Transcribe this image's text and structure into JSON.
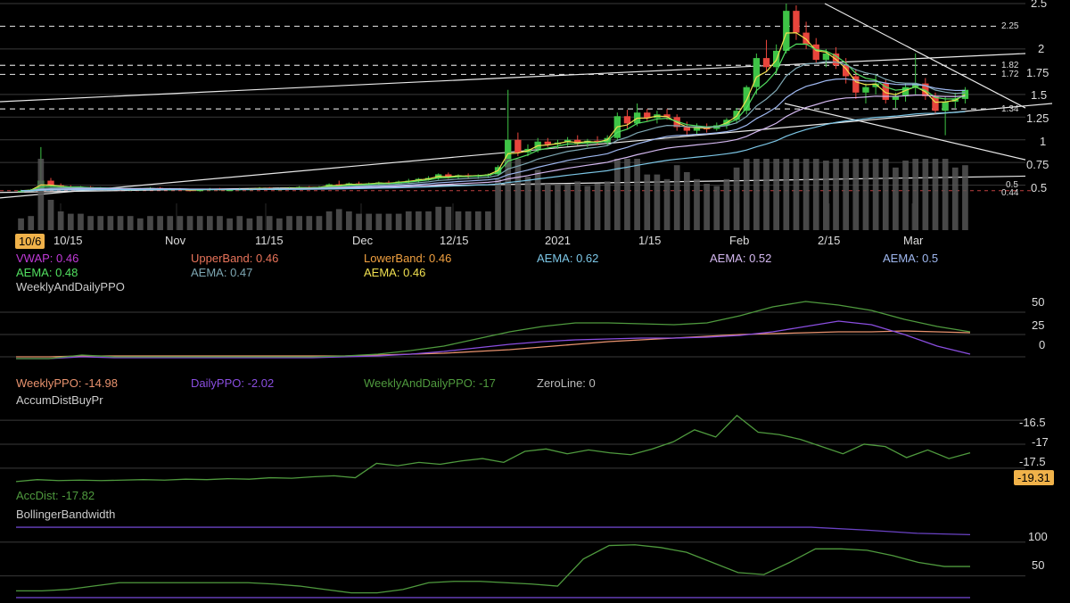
{
  "colors": {
    "up": "#3ec446",
    "down": "#e8453c",
    "volume": "#555555",
    "grid": "#3a3a3a",
    "ppo_weekly": "#e8926e",
    "ppo_daily": "#8a4ee0",
    "ppo_combined": "#4f9a3e",
    "accdist": "#4f9a3e",
    "bbw": "#4f9a3e",
    "bbw_upper": "#6a42c4",
    "badge": "#f0b24a"
  },
  "price_panel": {
    "y_ticks": [
      "2.5",
      "2.25",
      "2",
      "1.82",
      "1.72",
      "1.75",
      "1.5",
      "1.34",
      "1.25",
      "1",
      "0.75",
      "0.5",
      "0.5",
      "0.44"
    ],
    "x_ticks": [
      "10/6",
      "10/15",
      "Nov",
      "11/15",
      "Dec",
      "12/15",
      "2021",
      "1/15",
      "Feb",
      "2/15",
      "Mar"
    ],
    "legend": [
      {
        "text": "VWAP: 0.46",
        "color": "#c03ad8"
      },
      {
        "text": "UpperBand: 0.46",
        "color": "#e8735a"
      },
      {
        "text": "LowerBand: 0.46",
        "color": "#f0a040"
      },
      {
        "text": "AEMA: 0.62",
        "color": "#7cc6e6"
      },
      {
        "text": "AEMA: 0.52",
        "color": "#d4b8f0"
      },
      {
        "text": "AEMA: 0.5",
        "color": "#9fb8f0"
      },
      {
        "text": "AEMA: 0.48",
        "color": "#52e060"
      },
      {
        "text": "AEMA: 0.47",
        "color": "#7ea7b3"
      },
      {
        "text": "AEMA: 0.46",
        "color": "#f0e050"
      }
    ]
  },
  "ppo_panel": {
    "title": "WeeklyAndDailyPPO",
    "y_ticks": [
      "50",
      "25",
      "0"
    ],
    "legend": [
      {
        "text": "WeeklyPPO: -14.98",
        "color": "#e8926e"
      },
      {
        "text": "DailyPPO: -2.02",
        "color": "#8a4ee0"
      },
      {
        "text": "WeeklyAndDailyPPO: -17",
        "color": "#4f9a3e"
      },
      {
        "text": "ZeroLine: 0",
        "color": "#bbbbbb"
      }
    ]
  },
  "accdist_panel": {
    "title": "AccumDistBuyPr",
    "y_ticks": [
      "-16.5",
      "-17",
      "-17.5"
    ],
    "legend": {
      "text": "AccDist: -17.82",
      "color": "#4f9a3e"
    },
    "badge": "-19.31"
  },
  "bbw_panel": {
    "title": "BollingerBandwidth",
    "y_ticks": [
      "100",
      "50"
    ]
  },
  "chart_data": [
    {
      "type": "candlestick",
      "ylim": [
        0.3,
        2.5
      ],
      "x": [
        "10/6",
        "10/15",
        "Nov",
        "11/15",
        "Dec",
        "12/15",
        "2021",
        "1/15",
        "Feb",
        "2/15",
        "Mar"
      ],
      "series": [
        {
          "values": [
            [
              0.44,
              0.45,
              0.43,
              0.44
            ],
            [
              0.44,
              0.46,
              0.43,
              0.45
            ],
            [
              0.45,
              0.92,
              0.44,
              0.55
            ],
            [
              0.55,
              0.58,
              0.48,
              0.5
            ],
            [
              0.5,
              0.52,
              0.47,
              0.48
            ],
            [
              0.48,
              0.5,
              0.46,
              0.47
            ],
            [
              0.47,
              0.49,
              0.45,
              0.48
            ],
            [
              0.48,
              0.49,
              0.46,
              0.46
            ],
            [
              0.46,
              0.48,
              0.45,
              0.47
            ],
            [
              0.47,
              0.48,
              0.45,
              0.46
            ],
            [
              0.46,
              0.47,
              0.44,
              0.45
            ],
            [
              0.45,
              0.47,
              0.44,
              0.46
            ],
            [
              0.46,
              0.47,
              0.45,
              0.46
            ],
            [
              0.46,
              0.48,
              0.45,
              0.47
            ],
            [
              0.47,
              0.48,
              0.45,
              0.45
            ],
            [
              0.45,
              0.47,
              0.44,
              0.46
            ],
            [
              0.46,
              0.47,
              0.44,
              0.45
            ],
            [
              0.45,
              0.46,
              0.43,
              0.44
            ],
            [
              0.44,
              0.46,
              0.43,
              0.45
            ],
            [
              0.45,
              0.47,
              0.44,
              0.46
            ],
            [
              0.46,
              0.47,
              0.44,
              0.45
            ],
            [
              0.45,
              0.46,
              0.44,
              0.45
            ],
            [
              0.45,
              0.47,
              0.44,
              0.46
            ],
            [
              0.46,
              0.47,
              0.45,
              0.46
            ],
            [
              0.46,
              0.48,
              0.45,
              0.47
            ],
            [
              0.47,
              0.48,
              0.45,
              0.46
            ],
            [
              0.46,
              0.47,
              0.45,
              0.46
            ],
            [
              0.46,
              0.48,
              0.45,
              0.47
            ],
            [
              0.47,
              0.49,
              0.46,
              0.48
            ],
            [
              0.48,
              0.49,
              0.46,
              0.47
            ],
            [
              0.47,
              0.49,
              0.46,
              0.48
            ],
            [
              0.48,
              0.52,
              0.47,
              0.51
            ],
            [
              0.51,
              0.55,
              0.49,
              0.5
            ],
            [
              0.5,
              0.53,
              0.48,
              0.52
            ],
            [
              0.52,
              0.54,
              0.5,
              0.51
            ],
            [
              0.51,
              0.53,
              0.49,
              0.52
            ],
            [
              0.52,
              0.54,
              0.5,
              0.53
            ],
            [
              0.53,
              0.55,
              0.51,
              0.52
            ],
            [
              0.52,
              0.55,
              0.51,
              0.54
            ],
            [
              0.54,
              0.57,
              0.52,
              0.55
            ],
            [
              0.55,
              0.58,
              0.53,
              0.57
            ],
            [
              0.57,
              0.6,
              0.55,
              0.58
            ],
            [
              0.58,
              0.63,
              0.56,
              0.62
            ],
            [
              0.62,
              0.64,
              0.57,
              0.59
            ],
            [
              0.59,
              0.62,
              0.57,
              0.61
            ],
            [
              0.61,
              0.63,
              0.58,
              0.6
            ],
            [
              0.6,
              0.62,
              0.57,
              0.61
            ],
            [
              0.61,
              0.63,
              0.58,
              0.62
            ],
            [
              0.62,
              0.72,
              0.6,
              0.7
            ],
            [
              0.7,
              1.55,
              0.68,
              1.0
            ],
            [
              1.0,
              1.08,
              0.82,
              0.86
            ],
            [
              0.86,
              0.95,
              0.82,
              0.9
            ],
            [
              0.9,
              1.02,
              0.86,
              0.98
            ],
            [
              0.98,
              1.02,
              0.92,
              0.95
            ],
            [
              0.95,
              1.0,
              0.9,
              0.97
            ],
            [
              0.97,
              1.03,
              0.93,
              1.0
            ],
            [
              1.0,
              1.05,
              0.94,
              0.96
            ],
            [
              0.96,
              1.01,
              0.92,
              0.99
            ],
            [
              0.99,
              1.04,
              0.94,
              0.97
            ],
            [
              0.97,
              1.05,
              0.94,
              1.02
            ],
            [
              1.02,
              1.3,
              1.0,
              1.26
            ],
            [
              1.26,
              1.33,
              1.12,
              1.18
            ],
            [
              1.18,
              1.4,
              1.15,
              1.3
            ],
            [
              1.3,
              1.34,
              1.2,
              1.24
            ],
            [
              1.24,
              1.32,
              1.18,
              1.28
            ],
            [
              1.28,
              1.34,
              1.22,
              1.25
            ],
            [
              1.25,
              1.28,
              1.1,
              1.14
            ],
            [
              1.14,
              1.2,
              1.05,
              1.1
            ],
            [
              1.1,
              1.18,
              1.06,
              1.13
            ],
            [
              1.13,
              1.18,
              1.08,
              1.12
            ],
            [
              1.12,
              1.19,
              1.1,
              1.16
            ],
            [
              1.16,
              1.24,
              1.12,
              1.22
            ],
            [
              1.22,
              1.35,
              1.18,
              1.32
            ],
            [
              1.32,
              1.6,
              1.28,
              1.58
            ],
            [
              1.58,
              1.95,
              1.5,
              1.9
            ],
            [
              1.9,
              2.1,
              1.75,
              1.8
            ],
            [
              1.8,
              2.05,
              1.72,
              1.98
            ],
            [
              1.98,
              2.5,
              1.95,
              2.42
            ],
            [
              2.42,
              2.48,
              2.1,
              2.18
            ],
            [
              2.18,
              2.3,
              2.0,
              2.05
            ],
            [
              2.05,
              2.12,
              1.85,
              1.88
            ],
            [
              1.88,
              2.0,
              1.8,
              1.95
            ],
            [
              1.95,
              2.02,
              1.78,
              1.82
            ],
            [
              1.82,
              1.9,
              1.62,
              1.7
            ],
            [
              1.7,
              1.78,
              1.45,
              1.52
            ],
            [
              1.52,
              1.62,
              1.4,
              1.58
            ],
            [
              1.58,
              1.72,
              1.5,
              1.62
            ],
            [
              1.62,
              1.66,
              1.4,
              1.44
            ],
            [
              1.44,
              1.52,
              1.35,
              1.48
            ],
            [
              1.48,
              1.62,
              1.42,
              1.58
            ],
            [
              1.58,
              1.95,
              1.5,
              1.62
            ],
            [
              1.62,
              1.68,
              1.44,
              1.48
            ],
            [
              1.48,
              1.52,
              1.28,
              1.32
            ],
            [
              1.32,
              1.48,
              1.05,
              1.42
            ],
            [
              1.42,
              1.52,
              1.35,
              1.45
            ],
            [
              1.45,
              1.58,
              1.4,
              1.55
            ]
          ]
        }
      ]
    },
    {
      "type": "line",
      "ylim": [
        -10,
        70
      ],
      "series": [
        {
          "name": "WeeklyPPO",
          "values": [
            0,
            0,
            1,
            1,
            1,
            1,
            1,
            1,
            1,
            1,
            1,
            2,
            3,
            4,
            6,
            8,
            11,
            14,
            17,
            19,
            21,
            23,
            25,
            26,
            27,
            28,
            28,
            29,
            28,
            27
          ]
        },
        {
          "name": "DailyPPO",
          "values": [
            -2,
            -2,
            0,
            -1,
            -1,
            -1,
            -1,
            -1,
            -1,
            -1,
            0,
            1,
            3,
            6,
            10,
            14,
            17,
            19,
            20,
            21,
            21,
            22,
            24,
            28,
            34,
            40,
            36,
            25,
            12,
            3
          ]
        },
        {
          "name": "WeeklyAndDailyPPO",
          "values": [
            -2,
            -2,
            2,
            0,
            0,
            0,
            0,
            0,
            0,
            0,
            1,
            3,
            7,
            12,
            20,
            28,
            34,
            38,
            38,
            37,
            36,
            38,
            46,
            56,
            62,
            58,
            52,
            42,
            34,
            28
          ]
        }
      ]
    },
    {
      "type": "line",
      "ylim": [
        -17.82,
        -16.2
      ],
      "series": [
        {
          "name": "AccDist",
          "values": [
            -17.78,
            -17.74,
            -17.76,
            -17.75,
            -17.76,
            -17.75,
            -17.74,
            -17.75,
            -17.73,
            -17.74,
            -17.72,
            -17.73,
            -17.7,
            -17.71,
            -17.68,
            -17.66,
            -17.7,
            -17.4,
            -17.45,
            -17.38,
            -17.42,
            -17.35,
            -17.3,
            -17.38,
            -17.15,
            -17.1,
            -17.2,
            -17.12,
            -17.18,
            -17.22,
            -17.1,
            -16.95,
            -16.7,
            -16.85,
            -16.4,
            -16.75,
            -16.8,
            -16.9,
            -17.05,
            -17.2,
            -17.0,
            -17.05,
            -17.28,
            -17.12,
            -17.3,
            -17.18
          ]
        }
      ]
    },
    {
      "type": "line",
      "ylim": [
        10,
        130
      ],
      "series": [
        {
          "values": [
            28,
            28,
            30,
            35,
            40,
            40,
            40,
            40,
            40,
            40,
            38,
            35,
            30,
            25,
            25,
            30,
            40,
            42,
            42,
            40,
            38,
            35,
            75,
            95,
            96,
            92,
            85,
            70,
            55,
            52,
            70,
            90,
            90,
            88,
            80,
            70,
            64,
            64
          ]
        },
        {
          "values": [
            122,
            122,
            122,
            122,
            122,
            122,
            122,
            122,
            122,
            122,
            122,
            122,
            122,
            122,
            122,
            122,
            118,
            113,
            111
          ]
        },
        {
          "values": [
            18,
            18,
            18,
            18
          ]
        }
      ]
    }
  ]
}
